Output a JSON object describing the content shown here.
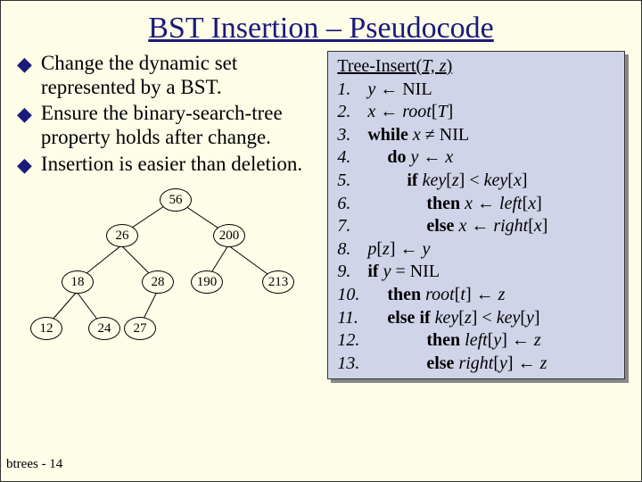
{
  "title": "BST Insertion – Pseudocode",
  "bullets": [
    "Change the dynamic set represented by a BST.",
    "Ensure the binary-search-tree property holds after change.",
    "Insertion is easier than deletion."
  ],
  "footer": "btrees - 14",
  "tree": {
    "nodes": [
      "56",
      "26",
      "200",
      "18",
      "28",
      "190",
      "213",
      "12",
      "24",
      "27"
    ]
  },
  "code": {
    "header_pre": "Tree-Insert(",
    "header_args": "T, z",
    "header_post": ")",
    "lines": [
      {
        "n": "1.",
        "indent": 0,
        "kind": "assign",
        "lhs": "y",
        "rhs_plain": "NIL"
      },
      {
        "n": "2.",
        "indent": 0,
        "kind": "assign",
        "lhs": "x",
        "rhs_rooti": "root",
        "rhs_idx": "T"
      },
      {
        "n": "3.",
        "indent": 0,
        "kind": "while_ne",
        "var": "x",
        "rhs": "NIL"
      },
      {
        "n": "4.",
        "indent": 1,
        "kind": "do_assign",
        "lhs": "y",
        "rhs": "x"
      },
      {
        "n": "5.",
        "indent": 2,
        "kind": "if_lt",
        "la": "key",
        "li": "z",
        "ra": "key",
        "ri": "x"
      },
      {
        "n": "6.",
        "indent": 3,
        "kind": "then_assign_arr",
        "lhs": "x",
        "arr": "left",
        "idx": "x"
      },
      {
        "n": "7.",
        "indent": 3,
        "kind": "else_assign_arr",
        "lhs": "x",
        "arr": "right",
        "idx": "x"
      },
      {
        "n": "8.",
        "indent": 0,
        "kind": "arr_assign",
        "arr": "p",
        "idx": "z",
        "rhs": "y"
      },
      {
        "n": "9.",
        "indent": 0,
        "kind": "if_eq",
        "lhs": "y",
        "rhs": "NIL"
      },
      {
        "n": "10.",
        "indent": 1,
        "kind": "then_assign_arr2",
        "arr": "root",
        "idx": "t",
        "rhs": "z"
      },
      {
        "n": "11.",
        "indent": 1,
        "kind": "elseif_lt",
        "la": "key",
        "li": "z",
        "ra": "key",
        "ri": "y"
      },
      {
        "n": "12.",
        "indent": 3,
        "kind": "then_assign_arr3",
        "arr": "left",
        "idx": "y",
        "rhs": "z"
      },
      {
        "n": "13.",
        "indent": 3,
        "kind": "else_assign_arr3",
        "arr": "right",
        "idx": "y",
        "rhs": "z"
      }
    ]
  },
  "chart_data": {
    "type": "tree",
    "title": "BST example",
    "nodes": {
      "56": {
        "left": "26",
        "right": "200"
      },
      "26": {
        "left": "18",
        "right": "28"
      },
      "200": {
        "left": "190",
        "right": "213"
      },
      "18": {
        "left": "12",
        "right": "24"
      },
      "28": {
        "left": "27"
      },
      "190": {},
      "213": {},
      "12": {},
      "24": {},
      "27": {}
    },
    "root": "56"
  }
}
